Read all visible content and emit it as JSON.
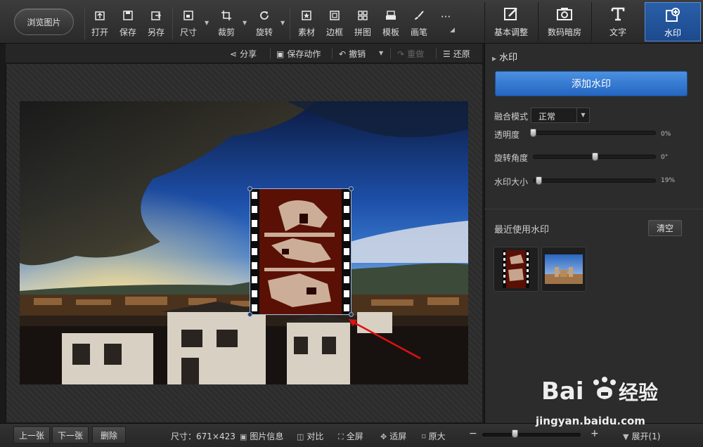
{
  "toolbar": {
    "browse_label": "浏览图片",
    "tools": [
      {
        "label": "打开",
        "icon": "open-icon"
      },
      {
        "label": "保存",
        "icon": "save-icon"
      },
      {
        "label": "另存",
        "icon": "save-as-icon"
      },
      {
        "label": "尺寸",
        "icon": "resize-icon"
      },
      {
        "label": "裁剪",
        "icon": "crop-icon"
      },
      {
        "label": "旋转",
        "icon": "rotate-icon"
      },
      {
        "label": "素材",
        "icon": "stickers-icon"
      },
      {
        "label": "边框",
        "icon": "border-icon"
      },
      {
        "label": "拼图",
        "icon": "collage-icon"
      },
      {
        "label": "模板",
        "icon": "template-icon"
      },
      {
        "label": "画笔",
        "icon": "brush-icon"
      },
      {
        "label": "···",
        "icon": "more-icon"
      }
    ]
  },
  "tabs": [
    {
      "label": "基本调整",
      "icon": "basic-adjust-icon"
    },
    {
      "label": "数码暗房",
      "icon": "darkroom-icon"
    },
    {
      "label": "文字",
      "icon": "text-icon"
    },
    {
      "label": "水印",
      "icon": "watermark-icon",
      "active": true
    }
  ],
  "subbar": {
    "share": "分享",
    "save_action": "保存动作",
    "undo": "撤销",
    "redo": "重做",
    "restore": "还原"
  },
  "panel": {
    "title": "水印",
    "add_button": "添加水印",
    "blend_label": "融合模式",
    "blend_value": "正常",
    "opacity_label": "透明度",
    "opacity_value": "0%",
    "opacity_level": 0,
    "rotation_label": "旋转角度",
    "rotation_value": "0°",
    "rotation_level": 0.5,
    "size_label": "水印大小",
    "size_value": "19%",
    "size_level": 0.19,
    "recent_title": "最近使用水印",
    "clear_button": "清空"
  },
  "bottom": {
    "prev": "上一张",
    "next": "下一张",
    "delete": "删除",
    "size_text": "尺寸：671×423",
    "info": "图片信息",
    "compare": "对比",
    "fullscreen": "全屏",
    "fit": "适屏",
    "original": "原大",
    "zoom_minus": "−",
    "zoom_plus": "+",
    "expand": "展开(1)"
  },
  "brand": {
    "logo_text": "Bai 经验",
    "url": "jingyan.baidu.com"
  },
  "colors": {
    "accent": "#2f74d0",
    "active_tab": "#1f4f99",
    "background": "#1a1a1a"
  }
}
